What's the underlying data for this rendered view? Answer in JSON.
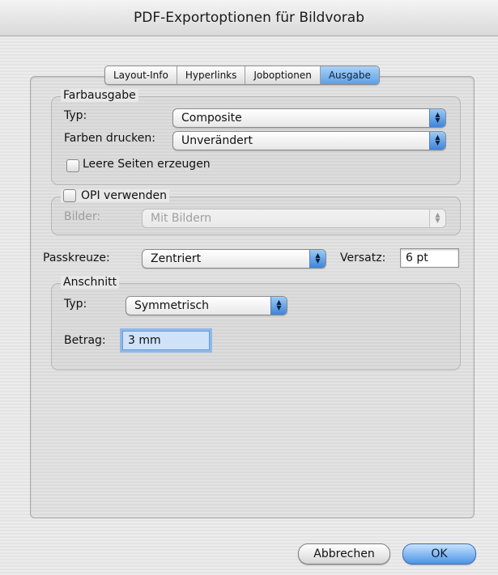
{
  "window": {
    "title": "PDF-Exportoptionen für Bildvorab"
  },
  "tabs": [
    {
      "label": "Layout-Info",
      "active": false
    },
    {
      "label": "Hyperlinks",
      "active": false
    },
    {
      "label": "Joboptionen",
      "active": false
    },
    {
      "label": "Ausgabe",
      "active": true
    }
  ],
  "farbausgabe": {
    "legend": "Farbausgabe",
    "typ_label": "Typ:",
    "typ_value": "Composite",
    "farben_label": "Farben drucken:",
    "farben_value": "Unverändert",
    "leere_seiten_label": "Leere Seiten erzeugen"
  },
  "opi": {
    "legend": "OPI verwenden",
    "bilder_label": "Bilder:",
    "bilder_value": "Mit Bildern"
  },
  "passkreuze": {
    "label": "Passkreuze:",
    "value": "Zentriert",
    "versatz_label": "Versatz:",
    "versatz_value": "6 pt"
  },
  "anschnitt": {
    "legend": "Anschnitt",
    "typ_label": "Typ:",
    "typ_value": "Symmetrisch",
    "betrag_label": "Betrag:",
    "betrag_value": "3 mm"
  },
  "buttons": {
    "cancel": "Abbrechen",
    "ok": "OK"
  },
  "icons": {
    "popup_arrows": "▲▼"
  },
  "colors": {
    "accent": "#5e9fe4"
  }
}
